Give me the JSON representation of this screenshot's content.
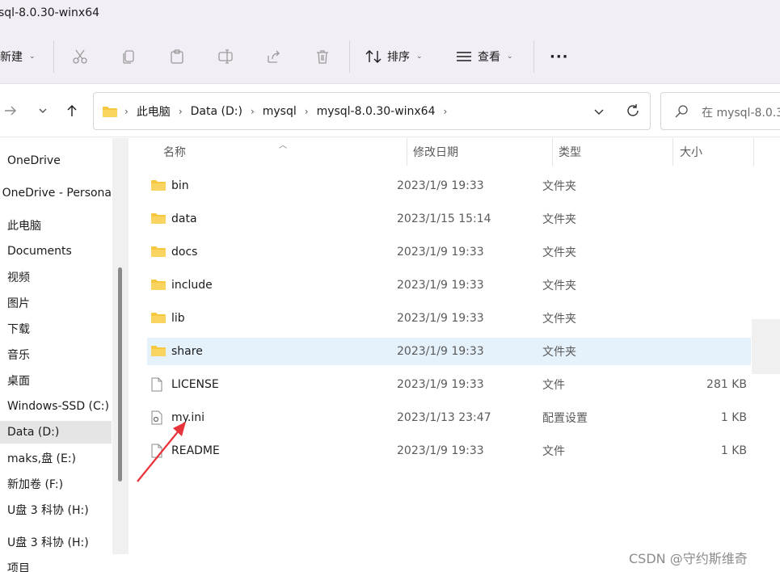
{
  "window": {
    "title": "sql-8.0.30-winx64"
  },
  "toolbar": {
    "new_label": "新建",
    "sort_label": "排序",
    "view_label": "查看",
    "more_label": "···"
  },
  "address": {
    "crumbs": [
      "此电脑",
      "Data (D:)",
      "mysql",
      "mysql-8.0.30-winx64"
    ],
    "search_placeholder": "在 mysql-8.0.3"
  },
  "sidebar": {
    "items": [
      {
        "label": "OneDrive",
        "icon": "cloud-icon"
      },
      {
        "label": "OneDrive - Persona",
        "icon": "cloud-icon"
      },
      {
        "label": "此电脑",
        "icon": "computer-icon"
      },
      {
        "label": "Documents",
        "icon": "document-icon"
      },
      {
        "label": "视频",
        "icon": "video-icon"
      },
      {
        "label": "图片",
        "icon": "picture-icon"
      },
      {
        "label": "下载",
        "icon": "download-icon"
      },
      {
        "label": "音乐",
        "icon": "music-icon"
      },
      {
        "label": "桌面",
        "icon": "desktop-icon"
      },
      {
        "label": "Windows-SSD (C:)",
        "icon": "drive-icon"
      },
      {
        "label": "Data (D:)",
        "icon": "drive-icon"
      },
      {
        "label": "maks,盘 (E:)",
        "icon": "drive-icon"
      },
      {
        "label": "新加卷 (F:)",
        "icon": "drive-icon"
      },
      {
        "label": "U盘 3 科协 (H:)",
        "icon": "usb-icon"
      },
      {
        "label": "U盘 3 科协 (H:)",
        "icon": "usb-icon"
      },
      {
        "label": "项目",
        "icon": "folder-icon"
      }
    ],
    "selected_index": 10
  },
  "filelist": {
    "columns": {
      "name": "名称",
      "date": "修改日期",
      "type": "类型",
      "size": "大小"
    },
    "rows": [
      {
        "name": "bin",
        "date": "2023/1/9 19:33",
        "type": "文件夹",
        "size": "",
        "kind": "folder"
      },
      {
        "name": "data",
        "date": "2023/1/15 15:14",
        "type": "文件夹",
        "size": "",
        "kind": "folder"
      },
      {
        "name": "docs",
        "date": "2023/1/9 19:33",
        "type": "文件夹",
        "size": "",
        "kind": "folder"
      },
      {
        "name": "include",
        "date": "2023/1/9 19:33",
        "type": "文件夹",
        "size": "",
        "kind": "folder"
      },
      {
        "name": "lib",
        "date": "2023/1/9 19:33",
        "type": "文件夹",
        "size": "",
        "kind": "folder"
      },
      {
        "name": "share",
        "date": "2023/1/9 19:33",
        "type": "文件夹",
        "size": "",
        "kind": "folder"
      },
      {
        "name": "LICENSE",
        "date": "2023/1/9 19:33",
        "type": "文件",
        "size": "281 KB",
        "kind": "file"
      },
      {
        "name": "my.ini",
        "date": "2023/1/13 23:47",
        "type": "配置设置",
        "size": "1 KB",
        "kind": "config"
      },
      {
        "name": "README",
        "date": "2023/1/9 19:33",
        "type": "文件",
        "size": "1 KB",
        "kind": "file"
      }
    ],
    "selected_index": 5
  },
  "watermark": "CSDN @守约斯维奇",
  "colors": {
    "folder": "#f8c740",
    "selection": "#e5f1fb",
    "arrow": "#e8333a",
    "chrome": "#f3eef6"
  }
}
